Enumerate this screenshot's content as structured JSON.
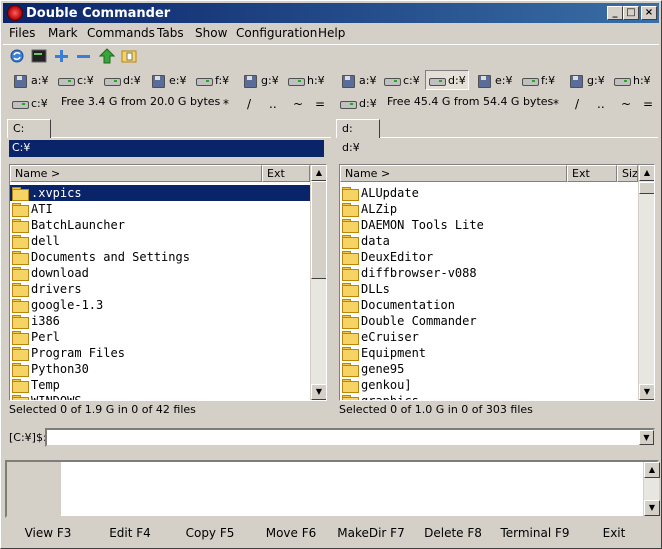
{
  "window": {
    "title": "Double Commander",
    "minimize": "_",
    "maximize": "□",
    "close": "×"
  },
  "menu": [
    "Files",
    "Mark",
    "Commands",
    "Tabs",
    "Show",
    "Configuration",
    "Help"
  ],
  "toolbar": {
    "icons": [
      "refresh-icon",
      "terminal-icon",
      "plus-icon",
      "minus-icon",
      "up-arrow-icon",
      "directory-hotlist-icon"
    ]
  },
  "left_drives": [
    "a:¥",
    "c:¥",
    "d:¥",
    "e:¥",
    "f:¥",
    "g:¥",
    "h:¥"
  ],
  "right_drives": [
    "a:¥",
    "c:¥",
    "d:¥",
    "e:¥",
    "f:¥",
    "g:¥",
    "h:¥"
  ],
  "left": {
    "drive": "c:¥",
    "free": "Free 3.4 G from 20.0 G bytes",
    "nav": [
      "*",
      "/",
      "..",
      "~",
      "="
    ],
    "tab": "C:",
    "path": "C:¥",
    "col_name": "Name >",
    "col_ext": "Ext",
    "rows": [
      ".xvpics",
      "ATI",
      "BatchLauncher",
      "dell",
      "Documents and Settings",
      "download",
      "drivers",
      "google-1.3",
      "i386",
      "Perl",
      "Program Files",
      "Python30",
      "Temp",
      "WINDOWS"
    ],
    "selected_index": 0,
    "status": "Selected 0 of 1.9 G in 0 of 42 files"
  },
  "right": {
    "drive": "d:¥",
    "free": "Free 45.4 G from 54.4 G bytes",
    "nav": [
      "*",
      "/",
      "..",
      "~",
      "="
    ],
    "tab": "d:",
    "path": "d:¥",
    "col_name": "Name >",
    "col_ext": "Ext",
    "col_size": "Size",
    "rows": [
      "ALUpdate",
      "ALZip",
      "DAEMON Tools Lite",
      "data",
      "DeuxEditor",
      "diffbrowser-v088",
      "DLLs",
      "Documentation",
      "Double Commander",
      "eCruiser",
      "Equipment",
      "gene95",
      "genkou]",
      "graphics"
    ],
    "status": "Selected 0 of 1.0 G in 0 of 303 files"
  },
  "cmdline": {
    "label": "[C:¥]$:",
    "value": ""
  },
  "fkeys": [
    "View F3",
    "Edit F4",
    "Copy F5",
    "Move F6",
    "MakeDir F7",
    "Delete F8",
    "Terminal F9",
    "Exit"
  ],
  "colors": {
    "titlebar": "#0a246a",
    "selection": "#0a246a",
    "face": "#d4d0c8"
  }
}
